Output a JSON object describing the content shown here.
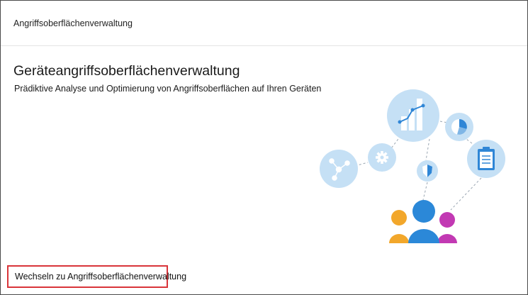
{
  "header": {
    "breadcrumb": "Angriffsoberflächenverwaltung"
  },
  "main": {
    "title": "Geräteangriffsoberflächenverwaltung",
    "subtitle": "Prädiktive Analyse und Optimierung von Angriffsoberflächen auf Ihren Geräten"
  },
  "footer": {
    "link_label": "Wechseln zu Angriffsoberflächenverwaltung"
  },
  "colors": {
    "bubble": "#c5e0f5",
    "icon_blue": "#2f86d6",
    "person_blue": "#2b88d8",
    "person_orange": "#f2a72b",
    "person_magenta": "#c239b3",
    "highlight_border": "#d9353a"
  },
  "illustration": {
    "icons": [
      "network-icon",
      "gear-icon",
      "chart-icon",
      "pie-chart-icon",
      "shield-icon",
      "clipboard-icon",
      "people-icon"
    ]
  }
}
